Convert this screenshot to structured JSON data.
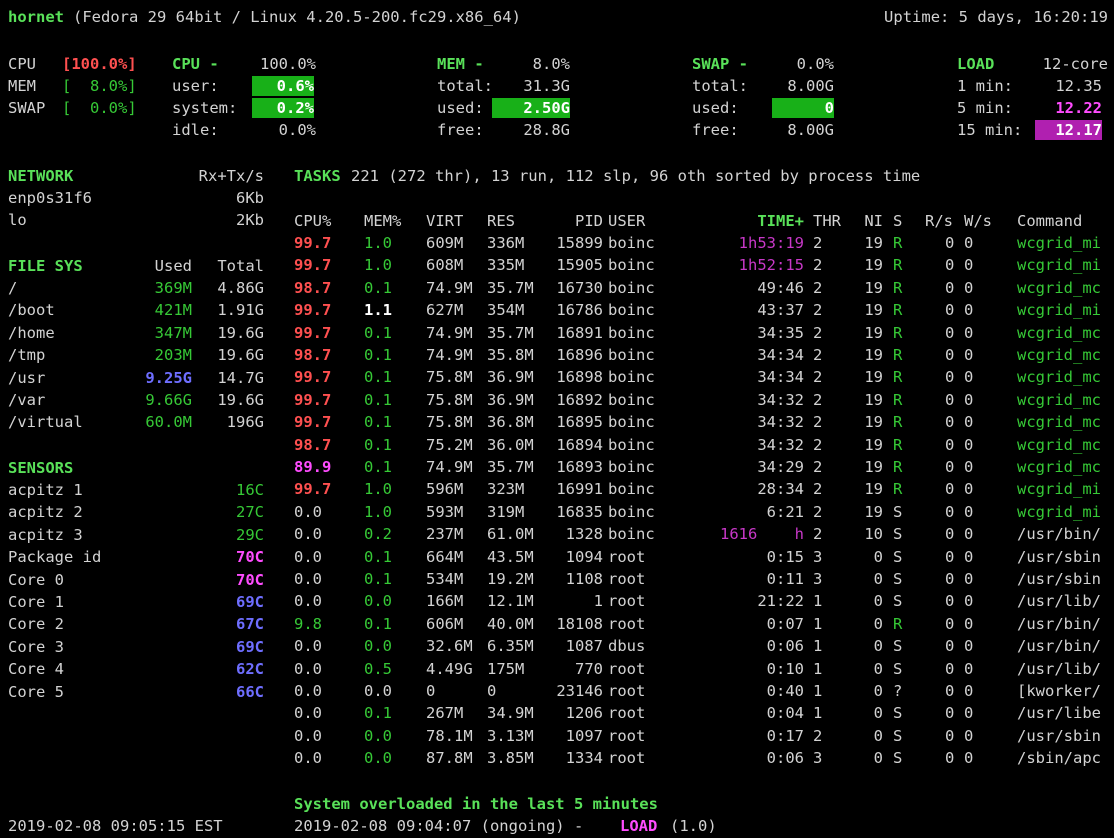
{
  "header": {
    "hostname": "hornet",
    "sysinfo": "(Fedora 29 64bit / Linux 4.20.5-200.fc29.x86_64)",
    "uptime": "Uptime: 5 days, 16:20:19"
  },
  "quicklook": {
    "cpu_label": "CPU",
    "cpu_val": "[100.0%]",
    "mem_label": "MEM",
    "mem_val": "[  8.0%]",
    "swap_label": "SWAP",
    "swap_val": "[  0.0%]"
  },
  "cpu": {
    "title": "CPU -",
    "total": "100.0%",
    "user_label": "user:",
    "user": "0.6%",
    "system_label": "system:",
    "system": "0.2%",
    "idle_label": "idle:",
    "idle": "0.0%"
  },
  "mem": {
    "title": "MEM -",
    "percent": "8.0%",
    "total_label": "total:",
    "total": "31.3G",
    "used_label": "used:",
    "used": "2.50G",
    "free_label": "free:",
    "free": "28.8G"
  },
  "swap": {
    "title": "SWAP -",
    "percent": "0.0%",
    "total_label": "total:",
    "total": "8.00G",
    "used_label": "used:",
    "used": "0",
    "free_label": "free:",
    "free": "8.00G"
  },
  "load": {
    "title": "LOAD",
    "cores": "12-core",
    "m1_label": "1 min:",
    "m1": "12.35",
    "m5_label": "5 min:",
    "m5": "12.22",
    "m15_label": "15 min:",
    "m15": "12.17"
  },
  "network": {
    "title": "NETWORK",
    "col": "Rx+Tx/s",
    "rows": [
      {
        "name": "enp0s31f6",
        "val": "6Kb"
      },
      {
        "name": "lo",
        "val": "2Kb"
      }
    ]
  },
  "filesys": {
    "title": "FILE SYS",
    "used_col": "Used",
    "total_col": "Total",
    "rows": [
      {
        "name": "/",
        "used": "369M",
        "total": "4.86G",
        "uc": "green"
      },
      {
        "name": "/boot",
        "used": "421M",
        "total": "1.91G",
        "uc": "green"
      },
      {
        "name": "/home",
        "used": "347M",
        "total": "19.6G",
        "uc": "green"
      },
      {
        "name": "/tmp",
        "used": "203M",
        "total": "19.6G",
        "uc": "green"
      },
      {
        "name": "/usr",
        "used": "9.25G",
        "total": "14.7G",
        "uc": "blue"
      },
      {
        "name": "/var",
        "used": "9.66G",
        "total": "19.6G",
        "uc": "green"
      },
      {
        "name": "/virtual",
        "used": "60.0M",
        "total": "196G",
        "uc": "green"
      }
    ]
  },
  "sensors": {
    "title": "SENSORS",
    "rows": [
      {
        "name": "acpitz 1",
        "val": "16C",
        "c": "green"
      },
      {
        "name": "acpitz 2",
        "val": "27C",
        "c": "green"
      },
      {
        "name": "acpitz 3",
        "val": "29C",
        "c": "green"
      },
      {
        "name": "Package id",
        "val": "70C",
        "c": "bmag"
      },
      {
        "name": "Core 0",
        "val": "70C",
        "c": "bmag"
      },
      {
        "name": "Core 1",
        "val": "69C",
        "c": "blue"
      },
      {
        "name": "Core 2",
        "val": "67C",
        "c": "blue"
      },
      {
        "name": "Core 3",
        "val": "69C",
        "c": "blue"
      },
      {
        "name": "Core 4",
        "val": "62C",
        "c": "blue"
      },
      {
        "name": "Core 5",
        "val": "66C",
        "c": "blue"
      }
    ]
  },
  "tasks": {
    "label": "TASKS",
    "summary": "221 (272 thr), 13 run, 112 slp, 96 oth sorted by process time"
  },
  "proc_headers": {
    "cpu": "CPU%",
    "mem": "MEM%",
    "virt": "VIRT",
    "res": "RES",
    "pid": "PID",
    "user": "USER",
    "time": "TIME+",
    "thr": "THR",
    "ni": "NI",
    "s": "S",
    "rs": "R/s",
    "ws": "W/s",
    "cmd": "Command"
  },
  "processes": [
    {
      "cpu": "99.7",
      "cc": "red",
      "mem": "1.0",
      "mc": "green",
      "virt": "609M",
      "res": "336M",
      "pid": "15899",
      "user": "boinc",
      "time": "1h53:19",
      "tc": "mag",
      "thr": "2",
      "ni": "19",
      "s": "R",
      "sc": "green",
      "rs": "0",
      "ws": "0",
      "cmd": "wcgrid_mi",
      "kc": "green"
    },
    {
      "cpu": "99.7",
      "cc": "red",
      "mem": "1.0",
      "mc": "green",
      "virt": "608M",
      "res": "335M",
      "pid": "15905",
      "user": "boinc",
      "time": "1h52:15",
      "tc": "mag",
      "thr": "2",
      "ni": "19",
      "s": "R",
      "sc": "green",
      "rs": "0",
      "ws": "0",
      "cmd": "wcgrid_mi",
      "kc": "green"
    },
    {
      "cpu": "98.7",
      "cc": "red",
      "mem": "0.1",
      "mc": "green",
      "virt": "74.9M",
      "res": "35.7M",
      "pid": "16730",
      "user": "boinc",
      "time": "49:46",
      "tc": "white",
      "thr": "2",
      "ni": "19",
      "s": "R",
      "sc": "green",
      "rs": "0",
      "ws": "0",
      "cmd": "wcgrid_mc",
      "kc": "green"
    },
    {
      "cpu": "99.7",
      "cc": "red",
      "mem": "1.1",
      "mc": "boldw",
      "virt": "627M",
      "res": "354M",
      "pid": "16786",
      "user": "boinc",
      "time": "43:37",
      "tc": "white",
      "thr": "2",
      "ni": "19",
      "s": "R",
      "sc": "green",
      "rs": "0",
      "ws": "0",
      "cmd": "wcgrid_mi",
      "kc": "green"
    },
    {
      "cpu": "99.7",
      "cc": "red",
      "mem": "0.1",
      "mc": "green",
      "virt": "74.9M",
      "res": "35.7M",
      "pid": "16891",
      "user": "boinc",
      "time": "34:35",
      "tc": "white",
      "thr": "2",
      "ni": "19",
      "s": "R",
      "sc": "green",
      "rs": "0",
      "ws": "0",
      "cmd": "wcgrid_mc",
      "kc": "green"
    },
    {
      "cpu": "98.7",
      "cc": "red",
      "mem": "0.1",
      "mc": "green",
      "virt": "74.9M",
      "res": "35.8M",
      "pid": "16896",
      "user": "boinc",
      "time": "34:34",
      "tc": "white",
      "thr": "2",
      "ni": "19",
      "s": "R",
      "sc": "green",
      "rs": "0",
      "ws": "0",
      "cmd": "wcgrid_mc",
      "kc": "green"
    },
    {
      "cpu": "99.7",
      "cc": "red",
      "mem": "0.1",
      "mc": "green",
      "virt": "75.8M",
      "res": "36.9M",
      "pid": "16898",
      "user": "boinc",
      "time": "34:34",
      "tc": "white",
      "thr": "2",
      "ni": "19",
      "s": "R",
      "sc": "green",
      "rs": "0",
      "ws": "0",
      "cmd": "wcgrid_mc",
      "kc": "green"
    },
    {
      "cpu": "99.7",
      "cc": "red",
      "mem": "0.1",
      "mc": "green",
      "virt": "75.8M",
      "res": "36.9M",
      "pid": "16892",
      "user": "boinc",
      "time": "34:32",
      "tc": "white",
      "thr": "2",
      "ni": "19",
      "s": "R",
      "sc": "green",
      "rs": "0",
      "ws": "0",
      "cmd": "wcgrid_mc",
      "kc": "green"
    },
    {
      "cpu": "99.7",
      "cc": "red",
      "mem": "0.1",
      "mc": "green",
      "virt": "75.8M",
      "res": "36.8M",
      "pid": "16895",
      "user": "boinc",
      "time": "34:32",
      "tc": "white",
      "thr": "2",
      "ni": "19",
      "s": "R",
      "sc": "green",
      "rs": "0",
      "ws": "0",
      "cmd": "wcgrid_mc",
      "kc": "green"
    },
    {
      "cpu": "98.7",
      "cc": "red",
      "mem": "0.1",
      "mc": "green",
      "virt": "75.2M",
      "res": "36.0M",
      "pid": "16894",
      "user": "boinc",
      "time": "34:32",
      "tc": "white",
      "thr": "2",
      "ni": "19",
      "s": "R",
      "sc": "green",
      "rs": "0",
      "ws": "0",
      "cmd": "wcgrid_mc",
      "kc": "green"
    },
    {
      "cpu": "89.9",
      "cc": "bmag",
      "mem": "0.1",
      "mc": "green",
      "virt": "74.9M",
      "res": "35.7M",
      "pid": "16893",
      "user": "boinc",
      "time": "34:29",
      "tc": "white",
      "thr": "2",
      "ni": "19",
      "s": "R",
      "sc": "green",
      "rs": "0",
      "ws": "0",
      "cmd": "wcgrid_mc",
      "kc": "green"
    },
    {
      "cpu": "99.7",
      "cc": "red",
      "mem": "1.0",
      "mc": "green",
      "virt": "596M",
      "res": "323M",
      "pid": "16991",
      "user": "boinc",
      "time": "28:34",
      "tc": "white",
      "thr": "2",
      "ni": "19",
      "s": "R",
      "sc": "green",
      "rs": "0",
      "ws": "0",
      "cmd": "wcgrid_mi",
      "kc": "green"
    },
    {
      "cpu": "0.0",
      "cc": "white",
      "mem": "1.0",
      "mc": "green",
      "virt": "593M",
      "res": "319M",
      "pid": "16835",
      "user": "boinc",
      "time": "6:21",
      "tc": "white",
      "thr": "2",
      "ni": "19",
      "s": "S",
      "sc": "white",
      "rs": "0",
      "ws": "0",
      "cmd": "wcgrid_mi",
      "kc": "green"
    },
    {
      "cpu": "0.0",
      "cc": "white",
      "mem": "0.2",
      "mc": "green",
      "virt": "237M",
      "res": "61.0M",
      "pid": "1328",
      "user": "boinc",
      "time": "1616    h",
      "tc": "mag",
      "thr": "2",
      "ni": "10",
      "s": "S",
      "sc": "white",
      "rs": "0",
      "ws": "0",
      "cmd": "/usr/bin/",
      "kc": "white"
    },
    {
      "cpu": "0.0",
      "cc": "white",
      "mem": "0.1",
      "mc": "green",
      "virt": "664M",
      "res": "43.5M",
      "pid": "1094",
      "user": "root",
      "time": "0:15",
      "tc": "white",
      "thr": "3",
      "ni": "0",
      "s": "S",
      "sc": "white",
      "rs": "0",
      "ws": "0",
      "cmd": "/usr/sbin",
      "kc": "white"
    },
    {
      "cpu": "0.0",
      "cc": "white",
      "mem": "0.1",
      "mc": "green",
      "virt": "534M",
      "res": "19.2M",
      "pid": "1108",
      "user": "root",
      "time": "0:11",
      "tc": "white",
      "thr": "3",
      "ni": "0",
      "s": "S",
      "sc": "white",
      "rs": "0",
      "ws": "0",
      "cmd": "/usr/sbin",
      "kc": "white"
    },
    {
      "cpu": "0.0",
      "cc": "white",
      "mem": "0.0",
      "mc": "green",
      "virt": "166M",
      "res": "12.1M",
      "pid": "1",
      "user": "root",
      "time": "21:22",
      "tc": "white",
      "thr": "1",
      "ni": "0",
      "s": "S",
      "sc": "white",
      "rs": "0",
      "ws": "0",
      "cmd": "/usr/lib/",
      "kc": "white"
    },
    {
      "cpu": "9.8",
      "cc": "green",
      "mem": "0.1",
      "mc": "green",
      "virt": "606M",
      "res": "40.0M",
      "pid": "18108",
      "user": "root",
      "time": "0:07",
      "tc": "white",
      "thr": "1",
      "ni": "0",
      "s": "R",
      "sc": "green",
      "rs": "0",
      "ws": "0",
      "cmd": "/usr/bin/",
      "kc": "white"
    },
    {
      "cpu": "0.0",
      "cc": "white",
      "mem": "0.0",
      "mc": "green",
      "virt": "32.6M",
      "res": "6.35M",
      "pid": "1087",
      "user": "dbus",
      "time": "0:06",
      "tc": "white",
      "thr": "1",
      "ni": "0",
      "s": "S",
      "sc": "white",
      "rs": "0",
      "ws": "0",
      "cmd": "/usr/bin/",
      "kc": "white"
    },
    {
      "cpu": "0.0",
      "cc": "white",
      "mem": "0.5",
      "mc": "green",
      "virt": "4.49G",
      "res": "175M",
      "pid": "770",
      "user": "root",
      "time": "0:10",
      "tc": "white",
      "thr": "1",
      "ni": "0",
      "s": "S",
      "sc": "white",
      "rs": "0",
      "ws": "0",
      "cmd": "/usr/lib/",
      "kc": "white"
    },
    {
      "cpu": "0.0",
      "cc": "white",
      "mem": "0.0",
      "mc": "white",
      "virt": "0",
      "res": "0",
      "pid": "23146",
      "user": "root",
      "time": "0:40",
      "tc": "white",
      "thr": "1",
      "ni": "0",
      "s": "?",
      "sc": "white",
      "rs": "0",
      "ws": "0",
      "cmd": "[kworker/",
      "kc": "white"
    },
    {
      "cpu": "0.0",
      "cc": "white",
      "mem": "0.1",
      "mc": "green",
      "virt": "267M",
      "res": "34.9M",
      "pid": "1206",
      "user": "root",
      "time": "0:04",
      "tc": "white",
      "thr": "1",
      "ni": "0",
      "s": "S",
      "sc": "white",
      "rs": "0",
      "ws": "0",
      "cmd": "/usr/libe",
      "kc": "white"
    },
    {
      "cpu": "0.0",
      "cc": "white",
      "mem": "0.0",
      "mc": "green",
      "virt": "78.1M",
      "res": "3.13M",
      "pid": "1097",
      "user": "root",
      "time": "0:17",
      "tc": "white",
      "thr": "2",
      "ni": "0",
      "s": "S",
      "sc": "white",
      "rs": "0",
      "ws": "0",
      "cmd": "/usr/sbin",
      "kc": "white"
    },
    {
      "cpu": "0.0",
      "cc": "white",
      "mem": "0.0",
      "mc": "green",
      "virt": "87.8M",
      "res": "3.85M",
      "pid": "1334",
      "user": "root",
      "time": "0:06",
      "tc": "white",
      "thr": "3",
      "ni": "0",
      "s": "S",
      "sc": "white",
      "rs": "0",
      "ws": "0",
      "cmd": "/sbin/apc",
      "kc": "white"
    }
  ],
  "alerts": {
    "title": "System overloaded in the last 5 minutes",
    "time": "2019-02-08 09:04:07 (ongoing) -",
    "type": "LOAD",
    "value": "(1.0)"
  },
  "footer": {
    "datetime": "2019-02-08 09:05:15 EST"
  }
}
